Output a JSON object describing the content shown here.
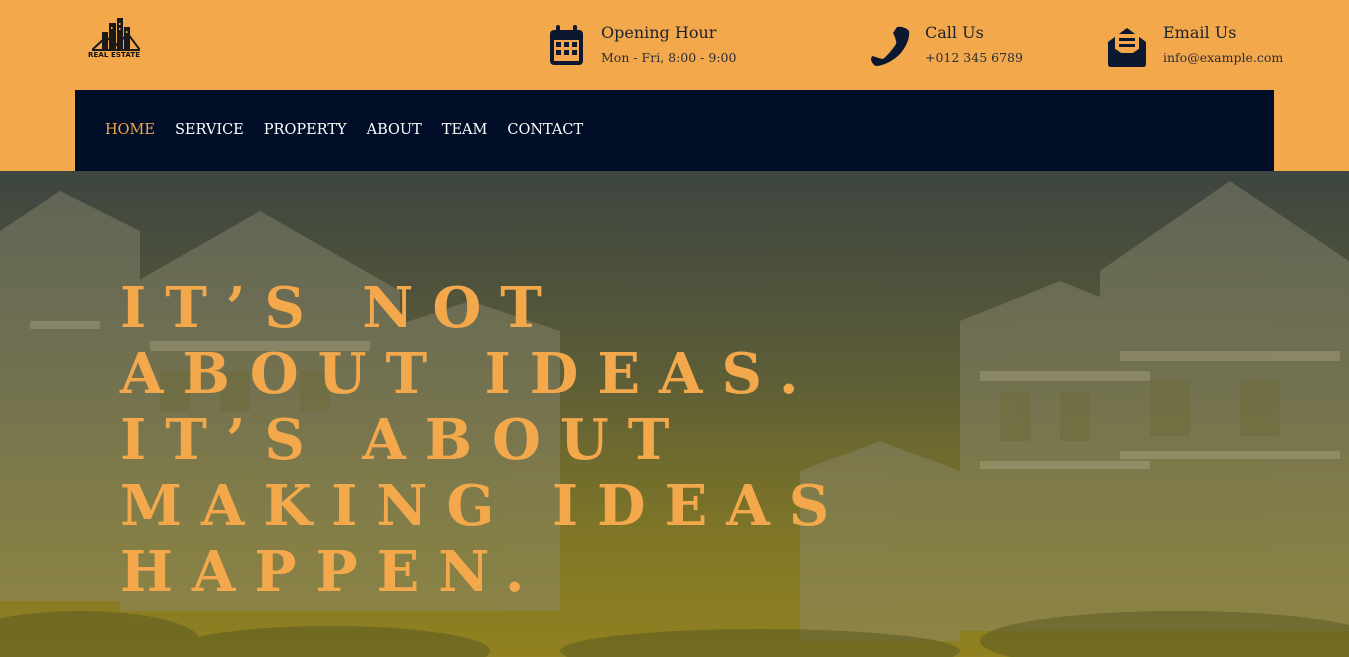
{
  "brand": {
    "logo_text": "REAL ESTATE"
  },
  "header": {
    "opening": {
      "icon": "calendar-icon",
      "title": "Opening Hour",
      "subtitle": "Mon - Fri, 8:00 - 9:00"
    },
    "call": {
      "icon": "phone-icon",
      "title": "Call Us",
      "subtitle": "+012 345 6789"
    },
    "email": {
      "icon": "envelope-open-icon",
      "title": "Email Us",
      "subtitle": "info@example.com"
    }
  },
  "nav": {
    "items": [
      "HOME",
      "SERVICE",
      "PROPERTY",
      "ABOUT",
      "TEAM",
      "CONTACT"
    ],
    "active": "HOME"
  },
  "hero": {
    "lines": [
      "IT’S NOT",
      "ABOUT IDEAS.",
      "IT’S ABOUT",
      "MAKING IDEAS",
      "HAPPEN."
    ]
  },
  "colors": {
    "accent": "#f2a84b",
    "nav_bg": "#000e27",
    "icon": "#0c1730"
  }
}
